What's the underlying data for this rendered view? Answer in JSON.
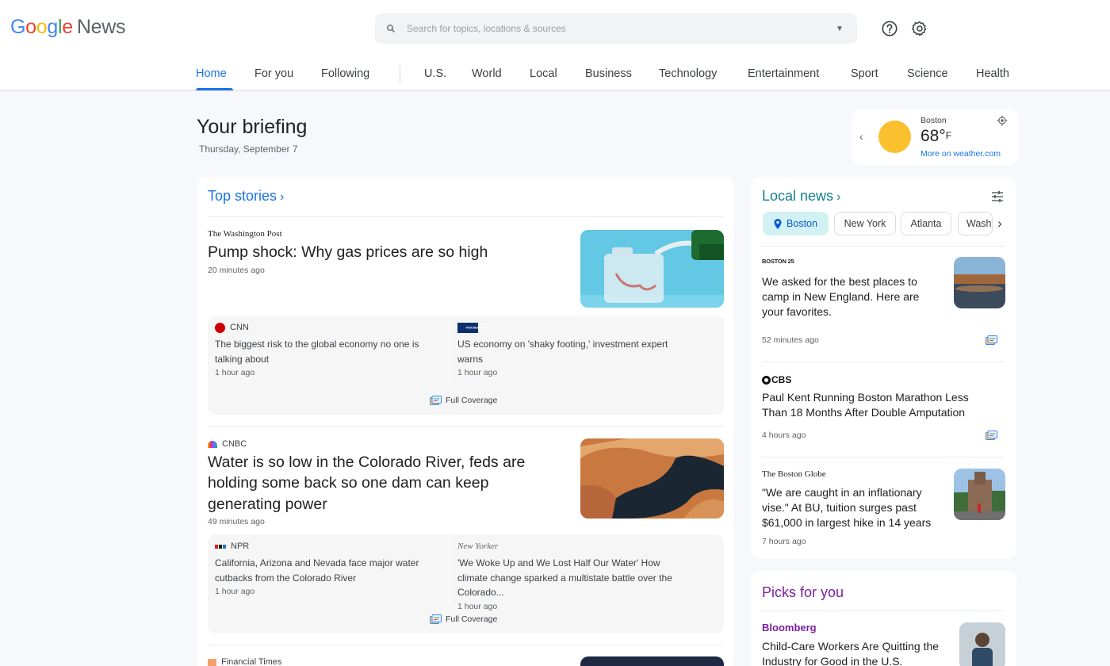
{
  "header": {
    "logo_google": "Google",
    "logo_news": "News",
    "search_placeholder": "Search for topics, locations & sources",
    "tabs": [
      "Home",
      "For you",
      "Following",
      "U.S.",
      "World",
      "Local",
      "Business",
      "Technology",
      "Entertainment",
      "Sport",
      "Science",
      "Health"
    ],
    "active_tab": "Home"
  },
  "briefing": {
    "title": "Your briefing",
    "date": "Thursday, September 7"
  },
  "weather": {
    "city": "Boston",
    "temp": "68°",
    "unit": "F",
    "link": "More on weather.com"
  },
  "top_stories": {
    "title": "Top stories",
    "full_coverage_label": "Full Coverage",
    "clusters": [
      {
        "source": "The Washington Post",
        "headline": "Pump shock: Why gas prices are so high",
        "time": "20 minutes ago",
        "related": [
          {
            "source": "CNN",
            "text": "The biggest risk to the global economy no one is talking about",
            "time": "1 hour ago"
          },
          {
            "source": "FOX BUSINESS",
            "text": "US economy on 'shaky footing,' investment expert warns",
            "time": "1 hour ago"
          }
        ]
      },
      {
        "source": "CNBC",
        "headline": "Water is so low in the Colorado River, feds are holding some back so one dam can keep generating power",
        "time": "49 minutes ago",
        "related": [
          {
            "source": "NPR",
            "text": "California, Arizona and Nevada face major water cutbacks from the Colorado River",
            "time": "1 hour ago"
          },
          {
            "source": "New Yorker",
            "text": "'We Woke Up and We Lost Half Our Water' How climate change sparked a multistate battle over the Colorado...",
            "time": "1 hour ago"
          }
        ]
      },
      {
        "source": "Financial Times"
      }
    ]
  },
  "local_news": {
    "title": "Local news",
    "chips": [
      "Boston",
      "New York",
      "Atlanta",
      "Washington"
    ],
    "active_chip": "Boston",
    "items": [
      {
        "source": "BOSTON 25",
        "headline": "We asked for the best places to camp in New England. Here are your favorites.",
        "time": "52 minutes ago"
      },
      {
        "source": "CBS",
        "headline": "Paul Kent Running Boston Marathon Less Than 18 Months After Double Amputation",
        "time": "4 hours ago"
      },
      {
        "source": "The Boston Globe",
        "headline": "\"We are caught in an inflationary vise.\" At BU, tuition surges past $61,000 in largest hike in 14 years",
        "time": "7 hours ago"
      }
    ]
  },
  "picks": {
    "title": "Picks for you",
    "items": [
      {
        "source": "Bloomberg",
        "headline": "Child-Care Workers Are Quitting the Industry for Good in the U.S."
      }
    ]
  },
  "colors": {
    "accent": "#1a73e8",
    "picks_accent": "#7b1fa2",
    "chip_active_bg": "#d2f1f3"
  }
}
